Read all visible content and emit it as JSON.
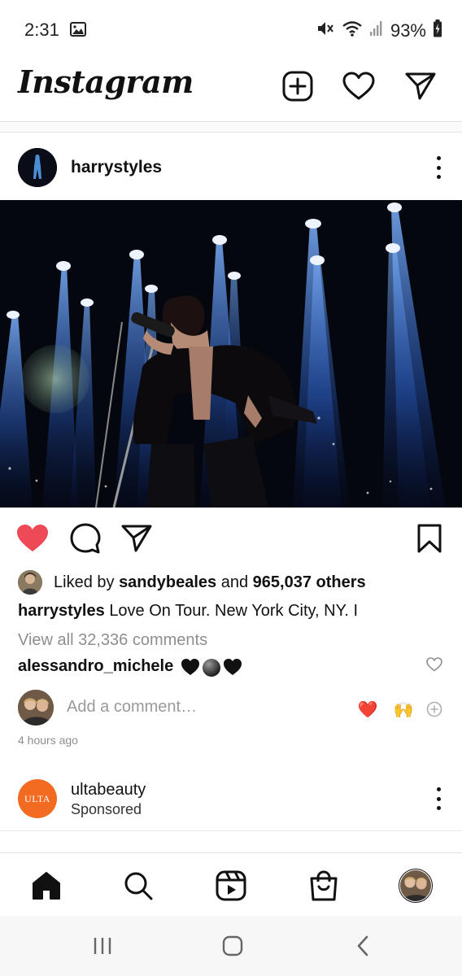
{
  "status_bar": {
    "time": "2:31",
    "battery": "93%",
    "icons": [
      "image-icon",
      "mute-icon",
      "wifi-icon",
      "signal-icon",
      "battery-charging-icon"
    ]
  },
  "header": {
    "logo": "Instagram",
    "icons": [
      "new-post-icon",
      "activity-heart-icon",
      "direct-message-icon"
    ]
  },
  "post": {
    "username": "harrystyles",
    "liked_by_prefix": "Liked by",
    "liked_by_user": "sandybeales",
    "liked_by_and": "and",
    "liked_by_others": "965,037 others",
    "caption_user": "harrystyles",
    "caption_text": "Love On Tour. New York City, NY. I",
    "view_comments": "View all 32,336 comments",
    "comment_user": "alessandro_michele",
    "comment_emoji": [
      "black-heart",
      "black-circle",
      "black-heart"
    ],
    "add_comment_placeholder": "Add a comment…",
    "quick_reactions": [
      "❤️",
      "🙌"
    ],
    "timestamp": "4 hours ago",
    "liked": true,
    "accent_color": "#ed4956"
  },
  "sponsored": {
    "logo_text": "ULTA",
    "username": "ultabeauty",
    "label": "Sponsored"
  },
  "bottom_nav": {
    "items": [
      "home-icon",
      "search-icon",
      "reels-icon",
      "shop-icon",
      "profile-avatar"
    ]
  },
  "system_nav": {
    "items": [
      "recent-apps-button",
      "home-button",
      "back-button"
    ]
  }
}
